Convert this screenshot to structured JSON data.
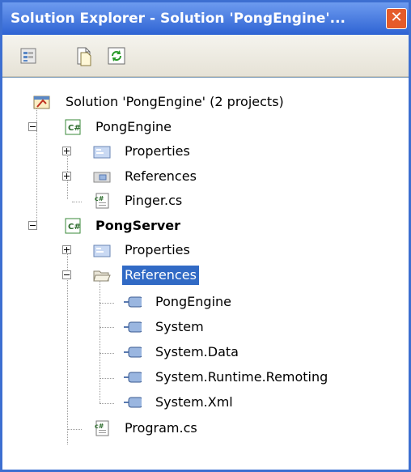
{
  "window": {
    "title": "Solution Explorer - Solution 'PongEngine'...",
    "close_glyph": "✕"
  },
  "toolbar": {
    "buttons": [
      {
        "name": "properties-icon"
      },
      {
        "name": "show-all-files-icon"
      },
      {
        "name": "refresh-icon"
      }
    ]
  },
  "tree": {
    "solution": "Solution 'PongEngine' (2 projects)",
    "project1": {
      "label": "PongEngine",
      "properties": "Properties",
      "references": "References",
      "file": "Pinger.cs"
    },
    "project2": {
      "label": "PongServer",
      "properties": "Properties",
      "references": "References",
      "refs": [
        "PongEngine",
        "System",
        "System.Data",
        "System.Runtime.Remoting",
        "System.Xml"
      ],
      "file": "Program.cs"
    }
  },
  "colors": {
    "titlebar": "#2e63d3",
    "selection": "#316ac5",
    "close": "#e55b2a"
  }
}
